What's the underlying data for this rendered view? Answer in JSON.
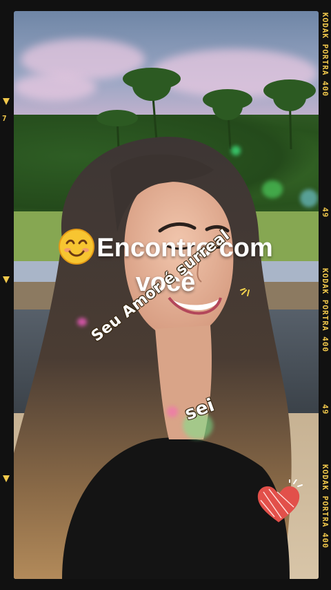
{
  "overlay": {
    "title_line1": "Encontro com",
    "title_line2": "você",
    "title_emoji": "smiling-face-icon",
    "lyric_line1": "Seu Amor é surreal",
    "lyric_line2": "sei"
  },
  "film": {
    "edge_text": "KODAK PORTRA 400",
    "frame_numbers": [
      "7",
      "49",
      "49"
    ]
  },
  "colors": {
    "film_accent": "#f2c94c",
    "heart": "#e2504a"
  }
}
